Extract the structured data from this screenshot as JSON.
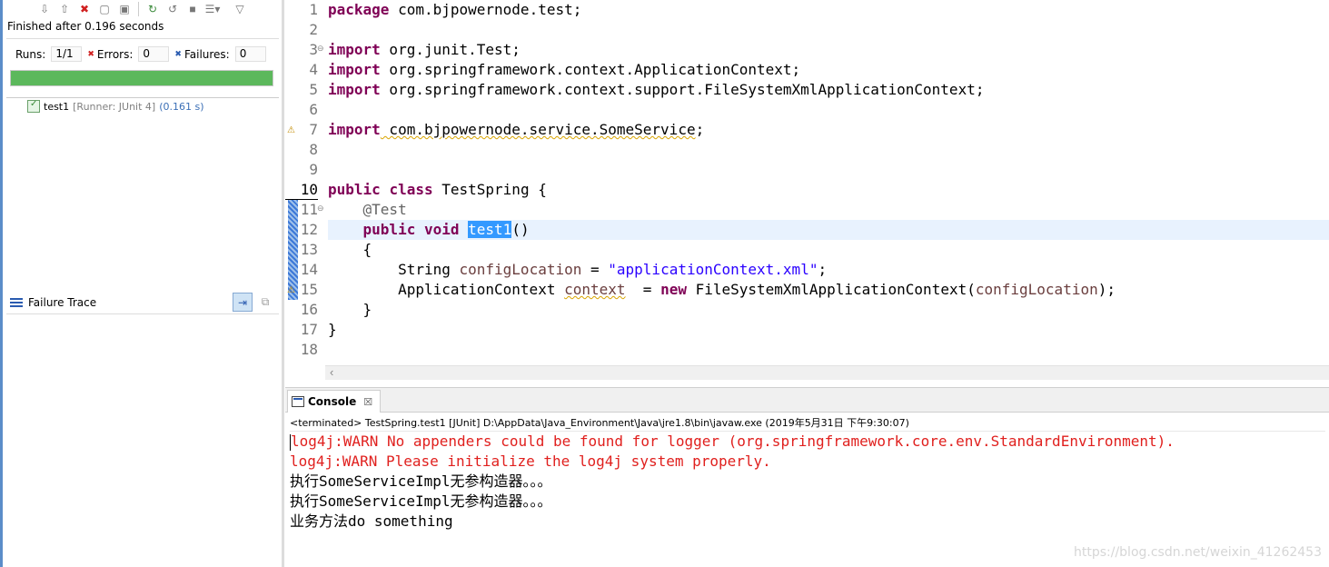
{
  "junit": {
    "toolbar_icons": [
      "next-failure-icon",
      "previous-failure-icon",
      "show-failures-only-icon",
      "scroll-lock-icon",
      "history-icon",
      "rerun-icon",
      "rerun-failed-icon",
      "stop-icon",
      "layout-menu-icon",
      "view-menu-icon"
    ],
    "finished": "Finished after 0.196 seconds",
    "runs_label": "Runs:",
    "runs_value": "1/1",
    "errors_label": "Errors:",
    "errors_value": "0",
    "failures_label": "Failures:",
    "failures_value": "0",
    "progress_fraction": 1.0,
    "progress_color": "#5cb85c",
    "test_name": "test1",
    "test_runner": "[Runner: JUnit 4]",
    "test_duration": "(0.161 s)",
    "failure_trace_label": "Failure Trace"
  },
  "editor": {
    "line_numbers": [
      "1",
      "2",
      "3",
      "4",
      "5",
      "6",
      "7",
      "8",
      "9",
      "10",
      "11",
      "12",
      "13",
      "14",
      "15",
      "16",
      "17",
      "18"
    ],
    "current_line": "10",
    "lines": {
      "l1_kw": "package",
      "l1_rest": " com.bjpowernode.test;",
      "l3_kw": "import",
      "l3_rest": " org.junit.Test;",
      "l4_kw": "import",
      "l4_rest": " org.springframework.context.ApplicationContext;",
      "l5_kw": "import",
      "l5_rest": " org.springframework.context.support.FileSystemXmlApplicationContext;",
      "l7_kw": "import",
      "l7_rest": " com.bjpowernode.service.SomeService",
      "l7_end": ";",
      "l10_kw1": "public",
      "l10_kw2": "class",
      "l10_rest": " TestSpring {",
      "l11_ann": "@Test",
      "l12_kw1": "public",
      "l12_kw2": "void",
      "l12_sel": "test1",
      "l12_rest": "()",
      "l13_text": "{",
      "l14_type": "String ",
      "l14_var": "configLocation",
      "l14_eq": " = ",
      "l14_str": "\"applicationContext.xml\"",
      "l14_end": ";",
      "l15_type": "ApplicationContext ",
      "l15_var": "context",
      "l15_eq": "  = ",
      "l15_kw": "new",
      "l15_call": " FileSystemXmlApplicationContext(",
      "l15_arg": "configLocation",
      "l15_end": ");",
      "l16_text": "}",
      "l17_text": "}"
    }
  },
  "console": {
    "tab_label": "Console",
    "tab_close": "☒",
    "terminated": "<terminated> TestSpring.test1 [JUnit] D:\\AppData\\Java_Environment\\Java\\jre1.8\\bin\\javaw.exe (2019年5月31日 下午9:30:07)",
    "output": [
      {
        "text": "log4j:WARN No appenders could be found for logger (org.springframework.core.env.StandardEnvironment).",
        "kind": "err"
      },
      {
        "text": "log4j:WARN Please initialize the log4j system properly.",
        "kind": "err"
      },
      {
        "text": "执行SomeServiceImpl无参构造器。。。",
        "kind": "std"
      },
      {
        "text": "执行SomeServiceImpl无参构造器。。。",
        "kind": "std"
      },
      {
        "text": "业务方法do something",
        "kind": "std"
      }
    ]
  },
  "watermark": "https://blog.csdn.net/weixin_41262453"
}
